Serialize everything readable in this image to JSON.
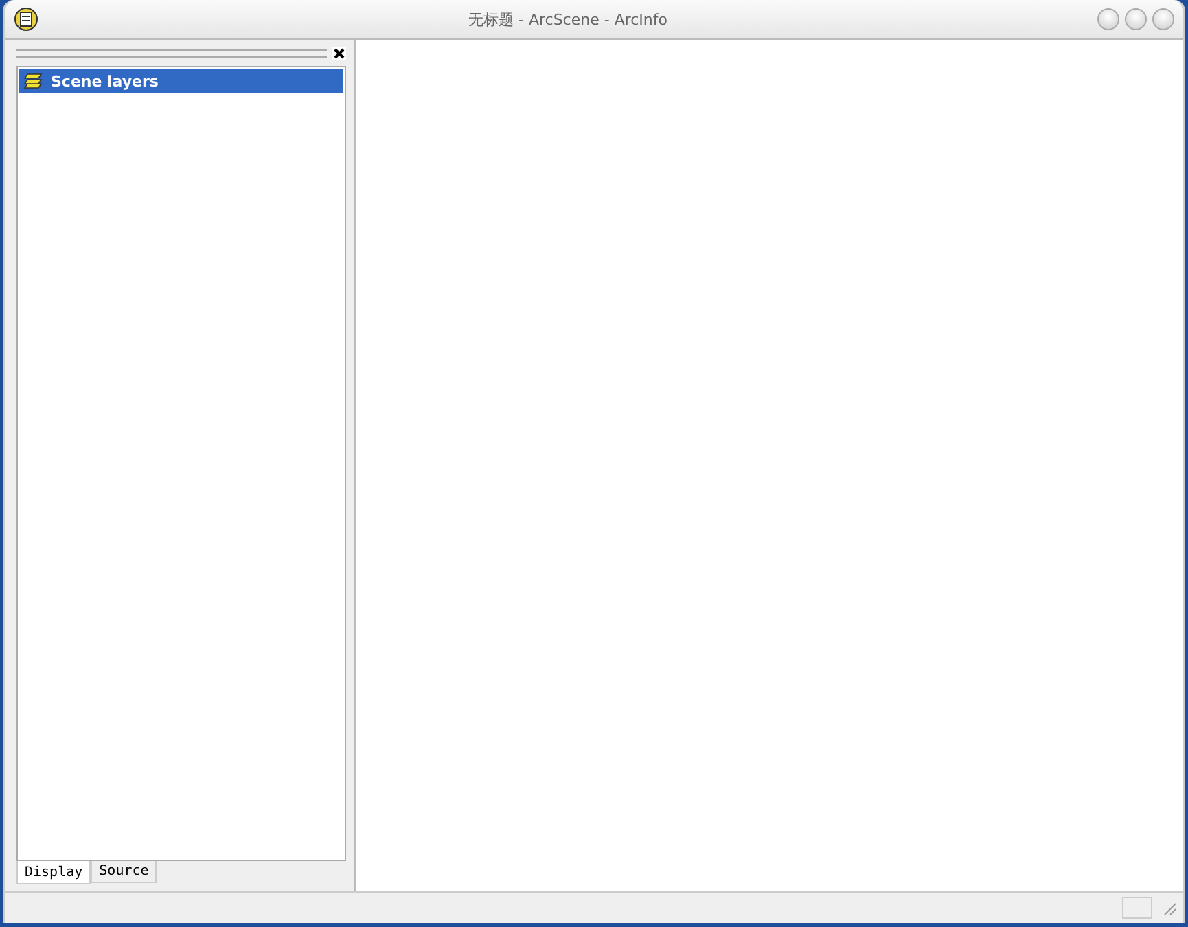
{
  "window": {
    "title": "无标题 - ArcScene - ArcInfo"
  },
  "toc": {
    "items": [
      {
        "label": "Scene layers",
        "selected": true
      }
    ]
  },
  "tabs": [
    {
      "label": "Display",
      "selected": true
    },
    {
      "label": "Source",
      "selected": false
    }
  ]
}
